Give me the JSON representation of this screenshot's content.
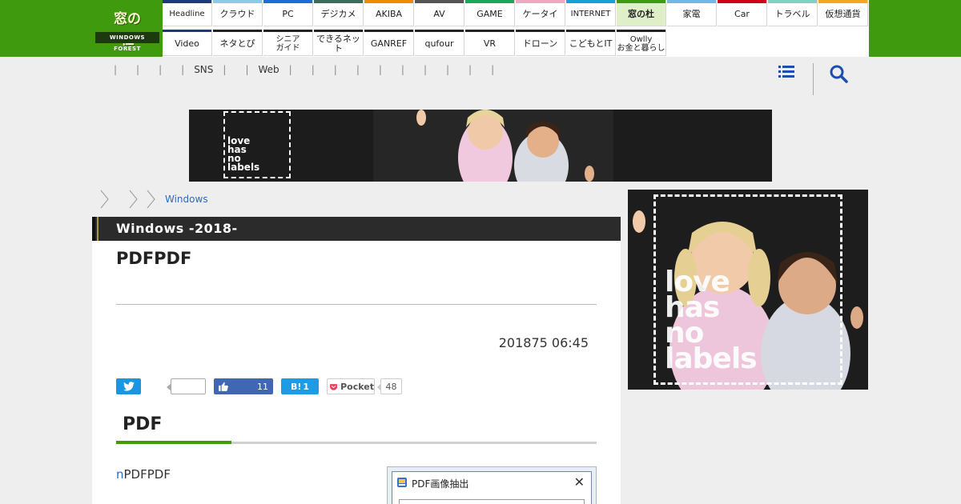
{
  "site": {
    "logo_text": "窓の杜",
    "logo_sub": "WINDOWS FOREST"
  },
  "nav": {
    "row1": [
      {
        "label": "Headline",
        "color": "#1b3a7a"
      },
      {
        "label": "クラウド",
        "color": "#8fc9e8"
      },
      {
        "label": "PC",
        "color": "#1c6fd0"
      },
      {
        "label": "デジカメ",
        "color": "#3b6d5a"
      },
      {
        "label": "AKIBA",
        "color": "#f08c00"
      },
      {
        "label": "AV",
        "color": "#555555"
      },
      {
        "label": "GAME",
        "color": "#19a85a"
      },
      {
        "label": "ケータイ",
        "color": "#f1a6c1"
      },
      {
        "label": "INTERNET",
        "color": "#1a9fd8"
      },
      {
        "label": "窓の杜",
        "color": "#3f9a0e"
      },
      {
        "label": "家電",
        "color": "#6fb8e8"
      },
      {
        "label": "Car",
        "color": "#d0021b"
      },
      {
        "label": "トラベル",
        "color": "#7fd1c0"
      },
      {
        "label": "仮想通貨",
        "color": "#f5a623"
      }
    ],
    "row2": [
      {
        "label": "Video",
        "color": "#1b3a7a"
      },
      {
        "label": "ネタとぴ",
        "color": "#222222"
      },
      {
        "label": "シニア\nガイド",
        "color": "#222222"
      },
      {
        "label": "できるネット",
        "color": "#222222"
      },
      {
        "label": "GANREF",
        "color": "#222222"
      },
      {
        "label": "qufour",
        "color": "#222222"
      },
      {
        "label": "VR",
        "color": "#222222"
      },
      {
        "label": "ドローン",
        "color": "#222222"
      },
      {
        "label": "こどもとIT",
        "color": "#222222"
      },
      {
        "label": "Owlly\nお金と暮らし",
        "color": "#222222"
      }
    ]
  },
  "subnav": {
    "items": [
      "",
      "",
      "",
      "",
      "SNS",
      "",
      "Web",
      "",
      "",
      "",
      "",
      "",
      "",
      "",
      "",
      "",
      ""
    ]
  },
  "banner_ad": {
    "copy": "love\nhas\nno\nlabels"
  },
  "breadcrumb": {
    "link": "Windows"
  },
  "article": {
    "series": "Windows -2018-",
    "title": "PDFPDF",
    "date": "201875 06:45",
    "share": {
      "twitter_count": "",
      "facebook_count": "11",
      "hatena_label": "B!",
      "hatena_count": "1",
      "pocket_label": "Pocket",
      "pocket_count": "48"
    },
    "section_heading": "PDF",
    "lead_n": "n",
    "lead_text": "PDFPDF",
    "dialog": {
      "title": "PDF画像抽出",
      "close": "✕"
    }
  },
  "side_ad": {
    "copy": "love\nhas\nno\nlabels"
  },
  "colors": {
    "brand_green": "#3f9a0e",
    "twitter": "#1b95e0",
    "facebook": "#4267b2",
    "hatena": "#1e9be2",
    "pocket": "#ef3f56"
  },
  "icons": {
    "menu": "hamburger-menu-icon",
    "search": "search-icon",
    "twitter": "twitter-bird-icon",
    "like": "thumbs-up-icon",
    "pocket": "pocket-icon"
  }
}
